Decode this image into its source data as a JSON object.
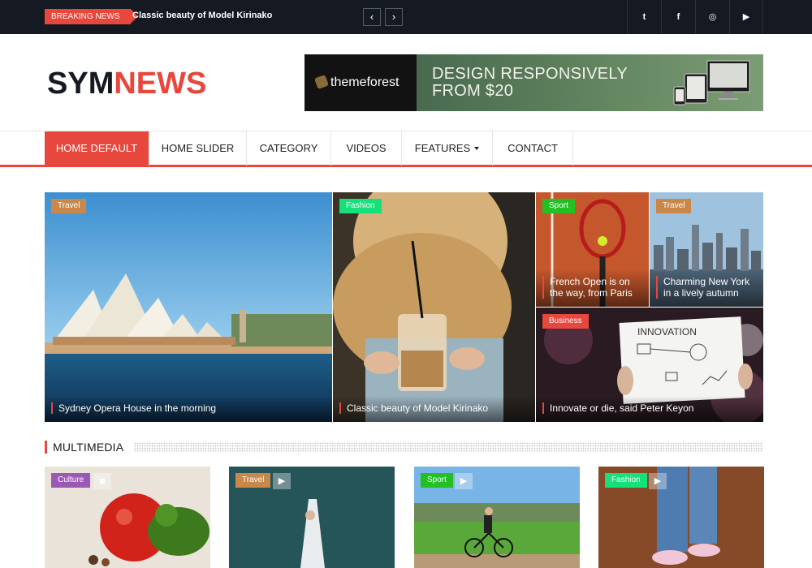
{
  "topbar": {
    "breaking_label": "BREAKING NEWS",
    "breaking_headline": "Classic beauty of Model Kirinako",
    "prev_icon": "chevron-left-icon",
    "next_icon": "chevron-right-icon",
    "prev_glyph": "‹",
    "next_glyph": "›",
    "social": [
      {
        "icon": "twitter-icon",
        "glyph": "t"
      },
      {
        "icon": "facebook-icon",
        "glyph": "f"
      },
      {
        "icon": "dribbble-icon",
        "glyph": "◎"
      },
      {
        "icon": "youtube-icon",
        "glyph": "▶"
      }
    ]
  },
  "header": {
    "logo_part1": "SYM",
    "logo_part2": "NEWS",
    "banner": {
      "brand": "themeforest",
      "headline_line1": "DESIGN RESPONSIVELY",
      "headline_line2": "FROM $20"
    }
  },
  "nav": {
    "items": [
      {
        "label": "HOME DEFAULT",
        "active": true
      },
      {
        "label": "HOME SLIDER"
      },
      {
        "label": "CATEGORY"
      },
      {
        "label": "VIDEOS"
      },
      {
        "label": "FEATURES",
        "dropdown": true
      },
      {
        "label": "CONTACT"
      }
    ]
  },
  "featured": [
    {
      "tag": "Travel",
      "tag_color": "#c9884a",
      "title": "Sydney Opera House in the morning"
    },
    {
      "tag": "Fashion",
      "tag_color": "#16e07a",
      "title": "Classic beauty of Model Kirinako"
    },
    {
      "tag": "Sport",
      "tag_color": "#22c022",
      "title": "French Open is on the way, from Paris"
    },
    {
      "tag": "Travel",
      "tag_color": "#c9884a",
      "title": "Charming New York in a lively autumn"
    },
    {
      "tag": "Business",
      "tag_color": "#e7473c",
      "title": "Innovate or die, said Peter Keyon",
      "image_text": "INNOVATION"
    }
  ],
  "multimedia": {
    "title": "MULTIMEDIA",
    "cards": [
      {
        "tag": "Culture",
        "tag_color": "#9b59b6",
        "media": "camera-icon",
        "glyph": "◙"
      },
      {
        "tag": "Travel",
        "tag_color": "#c9884a",
        "media": "play-icon",
        "glyph": "▶"
      },
      {
        "tag": "Sport",
        "tag_color": "#22c022",
        "media": "play-icon",
        "glyph": "▶"
      },
      {
        "tag": "Fashion",
        "tag_color": "#16e07a",
        "media": "play-icon",
        "glyph": "▶"
      }
    ]
  },
  "colors": {
    "accent": "#e7473c",
    "topbar_bg": "#151922"
  }
}
